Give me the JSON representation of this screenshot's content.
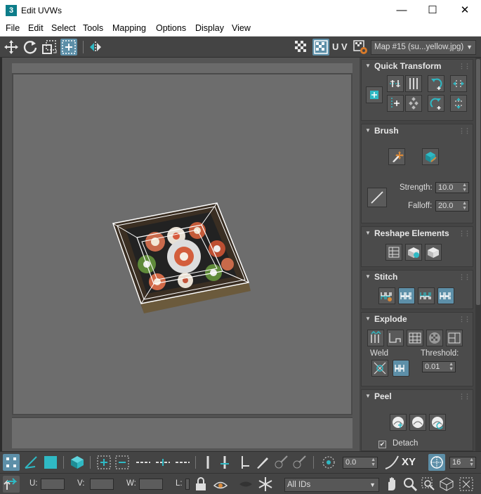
{
  "window": {
    "icon_label": "3",
    "title": "Edit UVWs",
    "minimize": "—",
    "maximize": "☐",
    "close": "✕"
  },
  "menu": [
    "File",
    "Edit",
    "Select",
    "Tools",
    "Mapping",
    "Options",
    "Display",
    "View"
  ],
  "toolbar": {
    "uv_label": "U V",
    "map_dropdown": "Map #15 (su...yellow.jpg)"
  },
  "panels": {
    "quick_transform": {
      "title": "Quick Transform"
    },
    "brush": {
      "title": "Brush",
      "strength_label": "Strength:",
      "strength_value": "10.0",
      "falloff_label": "Falloff:",
      "falloff_value": "20.0"
    },
    "reshape": {
      "title": "Reshape Elements"
    },
    "stitch": {
      "title": "Stitch"
    },
    "explode": {
      "title": "Explode",
      "weld_label": "Weld",
      "threshold_label": "Threshold:",
      "threshold_value": "0.01"
    },
    "peel": {
      "title": "Peel",
      "detach_label": "Detach",
      "detach_checked": true
    }
  },
  "bottom": {
    "angle_value": "0.0",
    "xy_label": "XY",
    "grid_value": "16",
    "u_label": "U:",
    "v_label": "V:",
    "w_label": "W:",
    "l_label": "L:",
    "ids_dropdown": "All IDs"
  },
  "colors": {
    "accent_teal": "#2fb9c4",
    "selection_white": "#ffffff",
    "panel_bg": "#4b4b4b",
    "viewport_bg": "#6d6d6d"
  }
}
